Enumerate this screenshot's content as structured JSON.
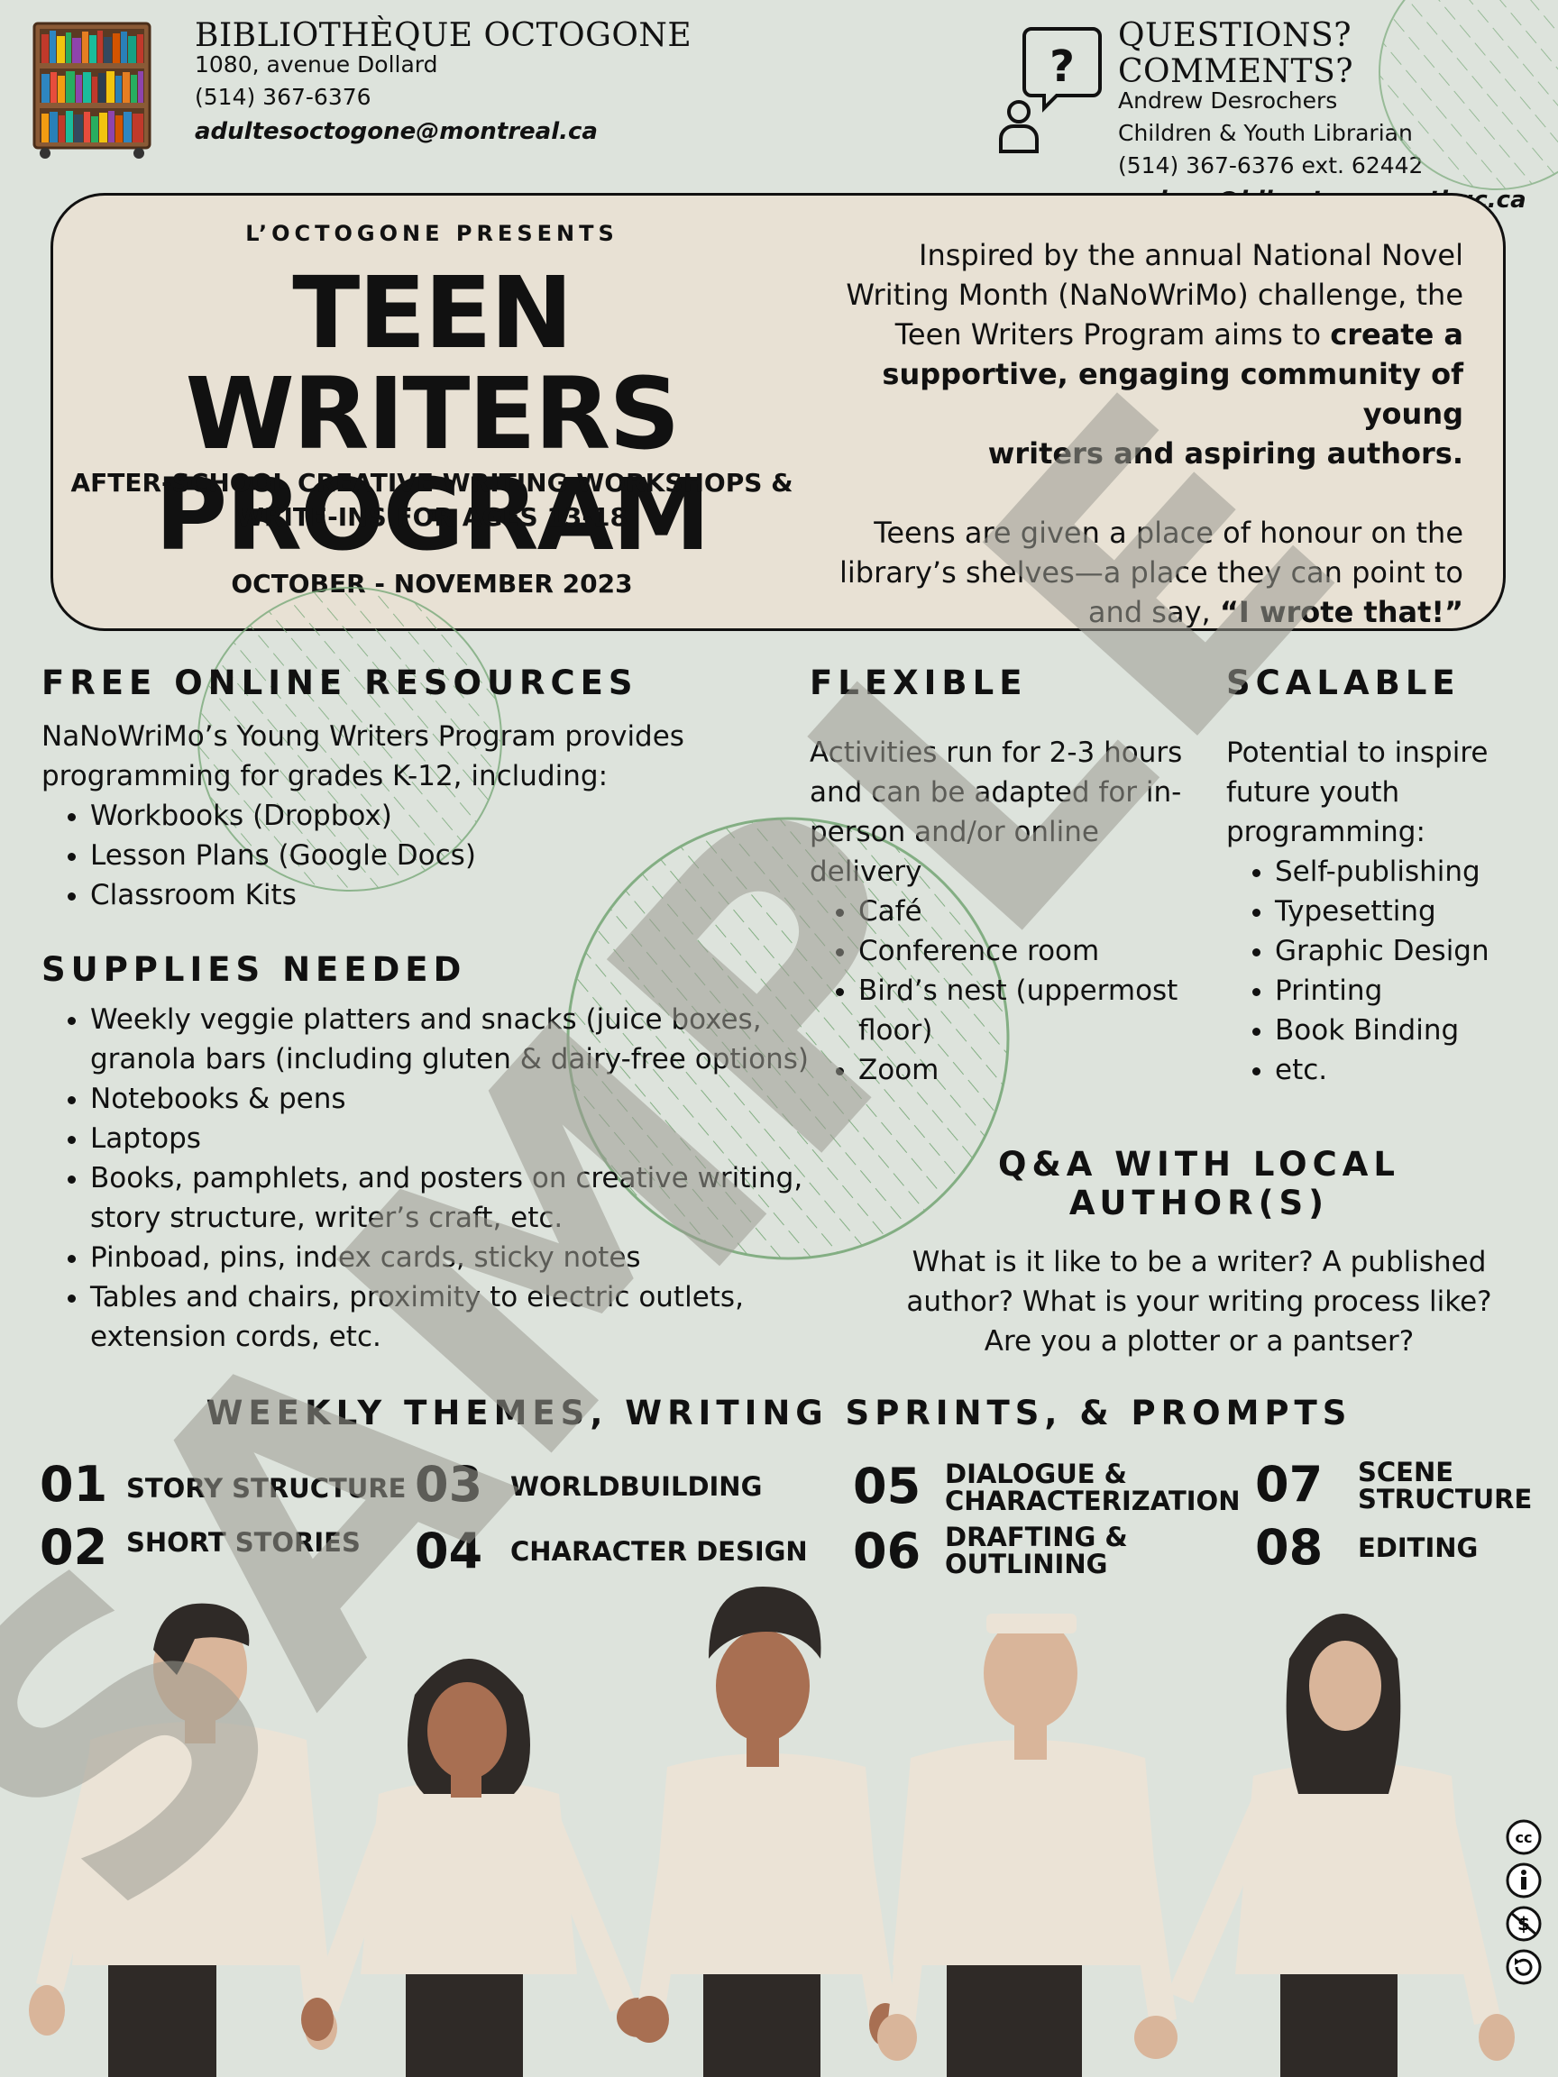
{
  "library": {
    "name": "BIBLIOTHÈQUE OCTOGONE",
    "address": "1080, avenue Dollard",
    "phone": "(514) 367-6376",
    "email": "adultesoctogone@montreal.ca"
  },
  "contact": {
    "heading": "QUESTIONS? COMMENTS?",
    "name": "Andrew Desrochers",
    "role": "Children & Youth Librarian",
    "phone": "(514) 367-6376 ext. 62442",
    "email": "andrew@biboctogonemtl.qc.ca"
  },
  "hero": {
    "kicker": "L’OCTOGONE PRESENTS",
    "title_line1": "TEEN WRITERS",
    "title_line2": "PROGRAM",
    "subtitle_line1": "AFTER-SCHOOL CREATIVE WRITING WORKSHOPS &",
    "subtitle_line2": "WRITE-INS FOR AGES 13-18",
    "dates": "OCTOBER - NOVEMBER 2023",
    "para1_lines": [
      "Inspired by the annual National Novel",
      "Writing Month (NaNoWriMo) challenge, the",
      "Teen Writers Program aims to ",
      "create a",
      "supportive, engaging community of young",
      "writers and aspiring authors."
    ],
    "para2_lines": [
      "Teens are given a place of honour on the",
      "library’s shelves—a place they can point to",
      "and say, ",
      "“I wrote that!”"
    ]
  },
  "resources": {
    "heading": "FREE ONLINE RESOURCES",
    "intro_line1": "NaNoWriMo’s Young Writers Program provides",
    "intro_line2": "programming for grades K-12, including:",
    "items": [
      "Workbooks (Dropbox)",
      "Lesson Plans (Google Docs)",
      "Classroom Kits"
    ]
  },
  "supplies": {
    "heading": "SUPPLIES NEEDED",
    "items": [
      [
        "Weekly veggie platters and snacks (juice boxes,",
        "granola bars (including gluten & dairy-free options)"
      ],
      [
        "Notebooks & pens"
      ],
      [
        "Laptops"
      ],
      [
        "Books, pamphlets, and posters on creative writing,",
        "story structure, writer’s craft, etc."
      ],
      [
        "Pinboad, pins, index cards, sticky notes"
      ],
      [
        "Tables and chairs, proximity to electric outlets,",
        "extension cords, etc."
      ]
    ]
  },
  "flexible": {
    "heading": "FLEXIBLE",
    "intro_lines": [
      "Activities run for 2-3 hours",
      "and can be adapted for in-",
      "person and/or online",
      "delivery"
    ],
    "items": [
      [
        "Café"
      ],
      [
        "Conference room"
      ],
      [
        "Bird’s nest (uppermost",
        "floor)"
      ],
      [
        "Zoom"
      ]
    ]
  },
  "scalable": {
    "heading": "SCALABLE",
    "intro_lines": [
      "Potential to inspire",
      "future youth",
      "programming:"
    ],
    "items": [
      "Self-publishing",
      "Typesetting",
      "Graphic Design",
      "Printing",
      "Book Binding",
      "etc."
    ]
  },
  "qa": {
    "heading": "Q&A WITH LOCAL AUTHOR(S)",
    "lines": [
      "What is it like to be a writer? A published",
      "author? What is your writing process like?",
      "Are you a plotter or a pantser?"
    ]
  },
  "themes": {
    "heading": "WEEKLY THEMES, WRITING SPRINTS, & PROMPTS",
    "items": [
      {
        "num": "01",
        "label": [
          "STORY STRUCTURE"
        ]
      },
      {
        "num": "02",
        "label": [
          "SHORT STORIES"
        ]
      },
      {
        "num": "03",
        "label": [
          "WORLDBUILDING"
        ]
      },
      {
        "num": "04",
        "label": [
          "CHARACTER DESIGN"
        ]
      },
      {
        "num": "05",
        "label": [
          "DIALOGUE &",
          "CHARACTERIZATION"
        ]
      },
      {
        "num": "06",
        "label": [
          "DRAFTING &",
          "OUTLINING"
        ]
      },
      {
        "num": "07",
        "label": [
          "SCENE",
          "STRUCTURE"
        ]
      },
      {
        "num": "08",
        "label": [
          "EDITING"
        ]
      }
    ]
  },
  "watermark": "SAMPLE",
  "license_icons": [
    "cc-icon",
    "by-icon",
    "nc-icon",
    "sa-icon"
  ],
  "colors": {
    "background": "#dde3dc",
    "hero_fill": "#e8e1d4",
    "watermark": "#b5b5ae",
    "accent_green": "#7aa97a",
    "skin_tan": "#d9b59a",
    "skin_brown": "#a86f52",
    "shirt": "#ebe3d6",
    "pants": "#2f2a27"
  }
}
